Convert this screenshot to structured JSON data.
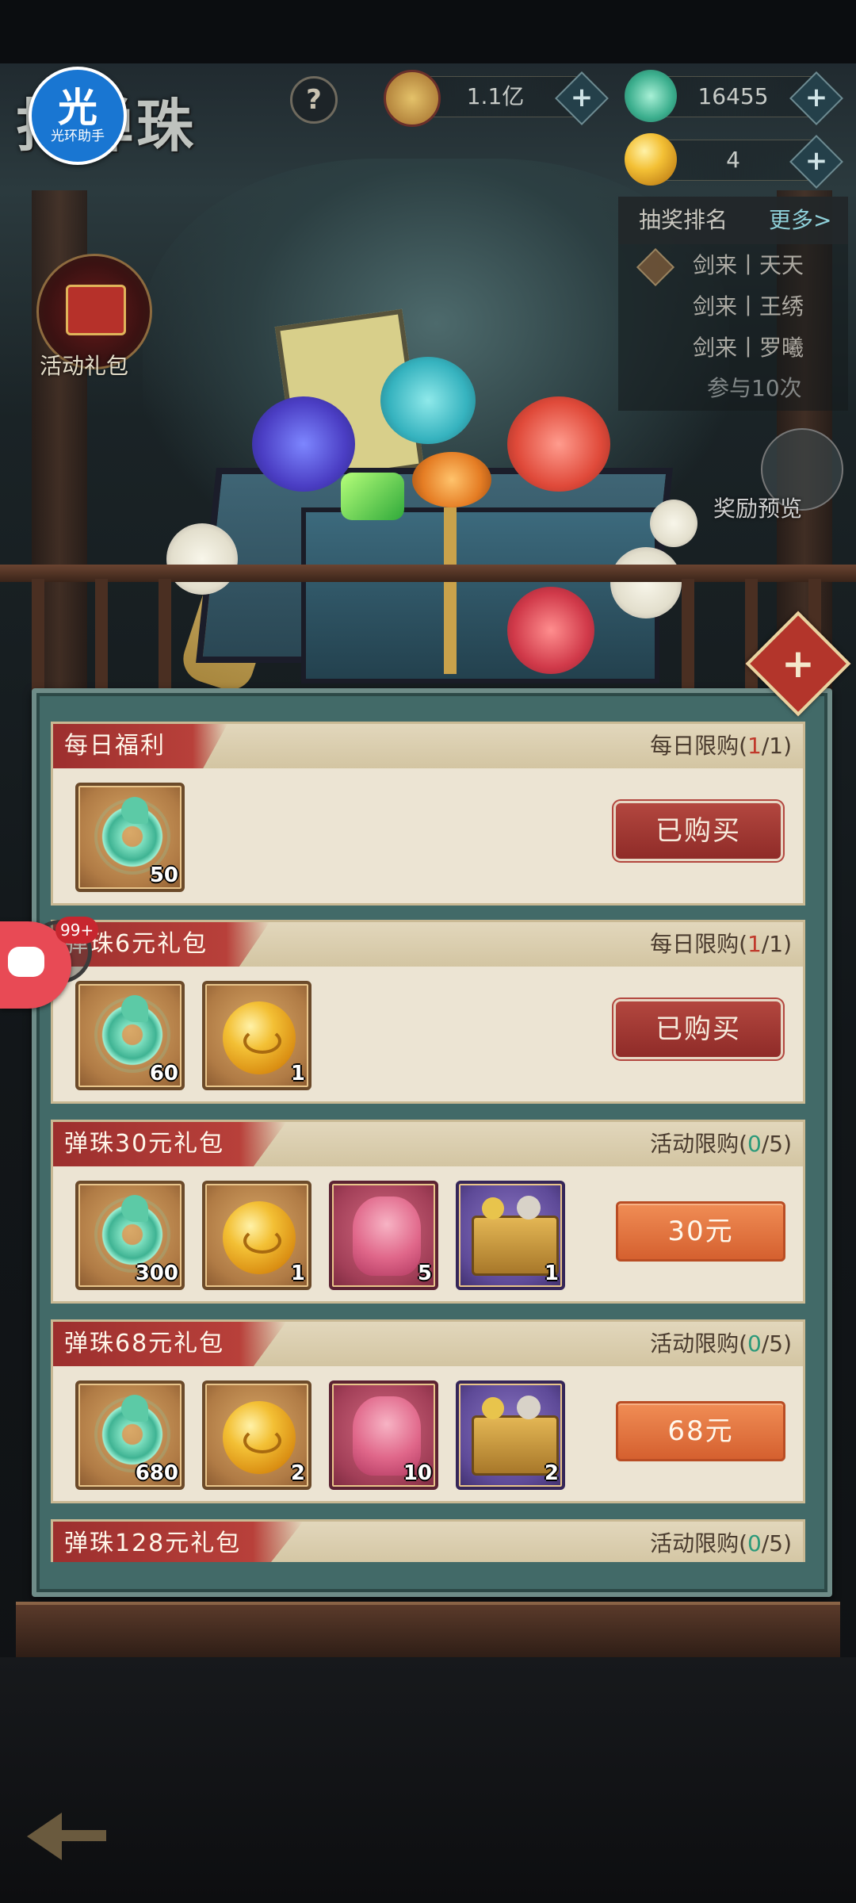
{
  "header": {
    "title_art": "打弹珠",
    "help_icon": "question-icon",
    "coins_value": "1.1亿",
    "jade_value": "16455",
    "gold_orb_value": "4"
  },
  "logo": {
    "big": "光",
    "small": "光环助手"
  },
  "ranking": {
    "title": "抽奖排名",
    "more": "更多>",
    "rows": [
      "剑来丨天天",
      "剑来丨王绣",
      "剑来丨罗曦"
    ],
    "footer": "参与10次"
  },
  "left_entry": {
    "label": "活动礼包"
  },
  "right_entry": {
    "label": "奖励预览"
  },
  "packs": [
    {
      "title": "每日福利",
      "limit_prefix": "每日限购(",
      "limit_current": "1",
      "limit_suffix": "/1)",
      "limit_color": "red",
      "items": [
        {
          "type": "jade",
          "qty": "50"
        }
      ],
      "button": "已购买",
      "button_state": "bought"
    },
    {
      "title": "弹珠6元礼包",
      "limit_prefix": "每日限购(",
      "limit_current": "1",
      "limit_suffix": "/1)",
      "limit_color": "red",
      "items": [
        {
          "type": "jade",
          "qty": "60"
        },
        {
          "type": "gold",
          "qty": "1"
        }
      ],
      "button": "已购买",
      "button_state": "bought"
    },
    {
      "title": "弹珠30元礼包",
      "limit_prefix": "活动限购(",
      "limit_current": "0",
      "limit_suffix": "/5)",
      "limit_color": "green",
      "items": [
        {
          "type": "jade",
          "qty": "300"
        },
        {
          "type": "gold",
          "qty": "1"
        },
        {
          "type": "beast",
          "qty": "5"
        },
        {
          "type": "chest",
          "qty": "1"
        }
      ],
      "button": "30元",
      "button_state": "buy"
    },
    {
      "title": "弹珠68元礼包",
      "limit_prefix": "活动限购(",
      "limit_current": "0",
      "limit_suffix": "/5)",
      "limit_color": "green",
      "items": [
        {
          "type": "jade",
          "qty": "680"
        },
        {
          "type": "gold",
          "qty": "2"
        },
        {
          "type": "beast",
          "qty": "10"
        },
        {
          "type": "chest",
          "qty": "2"
        }
      ],
      "button": "68元",
      "button_state": "buy"
    },
    {
      "title": "弹珠128元礼包",
      "limit_prefix": "活动限购(",
      "limit_current": "0",
      "limit_suffix": "/5)",
      "limit_color": "green",
      "items": [],
      "button": "",
      "button_state": "buy"
    }
  ],
  "assistant": {
    "badge": "99+"
  },
  "colors": {
    "accent_red": "#b8403a",
    "accent_green": "#2c9a7a",
    "buy_orange": "#e2743f"
  }
}
